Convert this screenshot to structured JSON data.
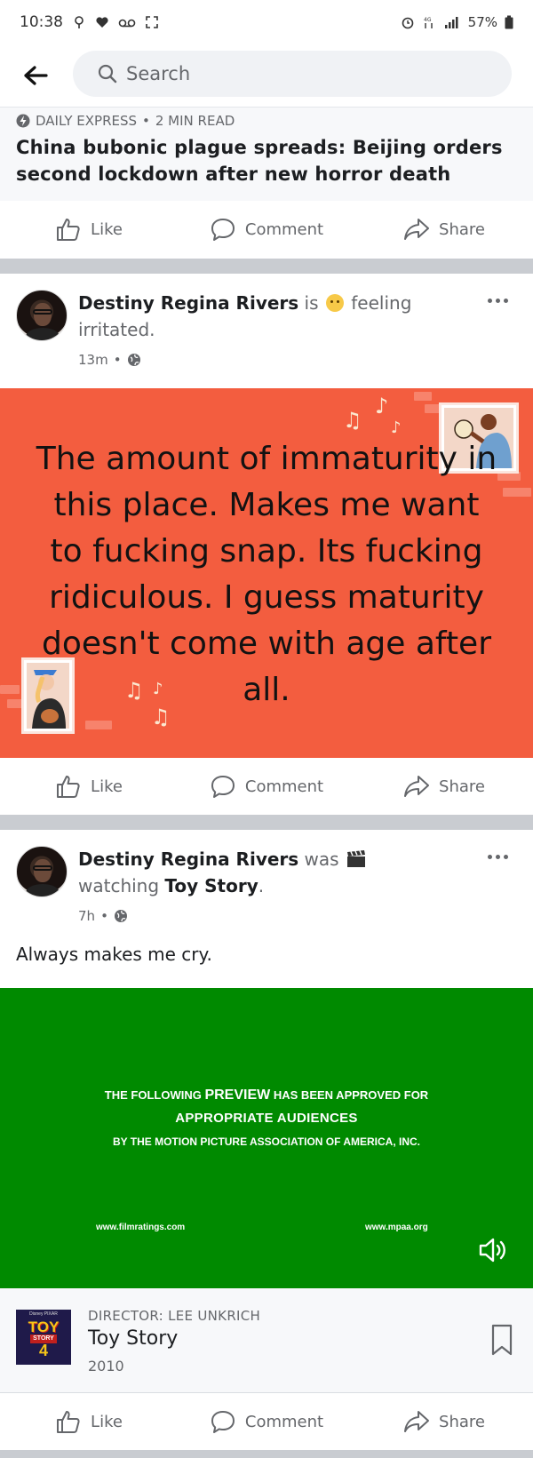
{
  "status_bar": {
    "time": "10:38",
    "battery": "57%"
  },
  "search": {
    "placeholder": "Search"
  },
  "article": {
    "source": "DAILY EXPRESS",
    "read_time": "2 MIN READ",
    "title": "China bubonic plague spreads: Beijing orders second lockdown after new horror death"
  },
  "actions": {
    "like": "Like",
    "comment": "Comment",
    "share": "Share"
  },
  "post1": {
    "author": "Destiny Regina Rivers",
    "verb_is": "is",
    "feeling_word": "feeling",
    "feeling_value": "irritated.",
    "time": "13m",
    "body": "The amount of immaturity in this place. Makes me want to fucking snap. Its fucking ridiculous. I guess maturity doesn't come with age after all.",
    "background_color": "#f35d3f"
  },
  "post2": {
    "author": "Destiny Regina Rivers",
    "verb_was": "was",
    "activity_word": "watching",
    "activity_object": "Toy Story",
    "period": ".",
    "time": "7h",
    "caption": "Always makes me cry."
  },
  "video": {
    "line1_pre": "THE FOLLOWING",
    "line1_big": "PREVIEW",
    "line1_post": "HAS BEEN APPROVED FOR",
    "line2": "APPROPRIATE AUDIENCES",
    "line3": "BY THE MOTION PICTURE ASSOCIATION OF AMERICA, INC.",
    "url_left": "www.filmratings.com",
    "url_right": "www.mpaa.org",
    "background_color": "#008a00"
  },
  "movie": {
    "director": "DIRECTOR: LEE UNKRICH",
    "title": "Toy Story",
    "year": "2010",
    "poster": {
      "studio": "Disney PIXAR",
      "word1": "TOY",
      "word2": "STORY",
      "number": "4"
    }
  }
}
